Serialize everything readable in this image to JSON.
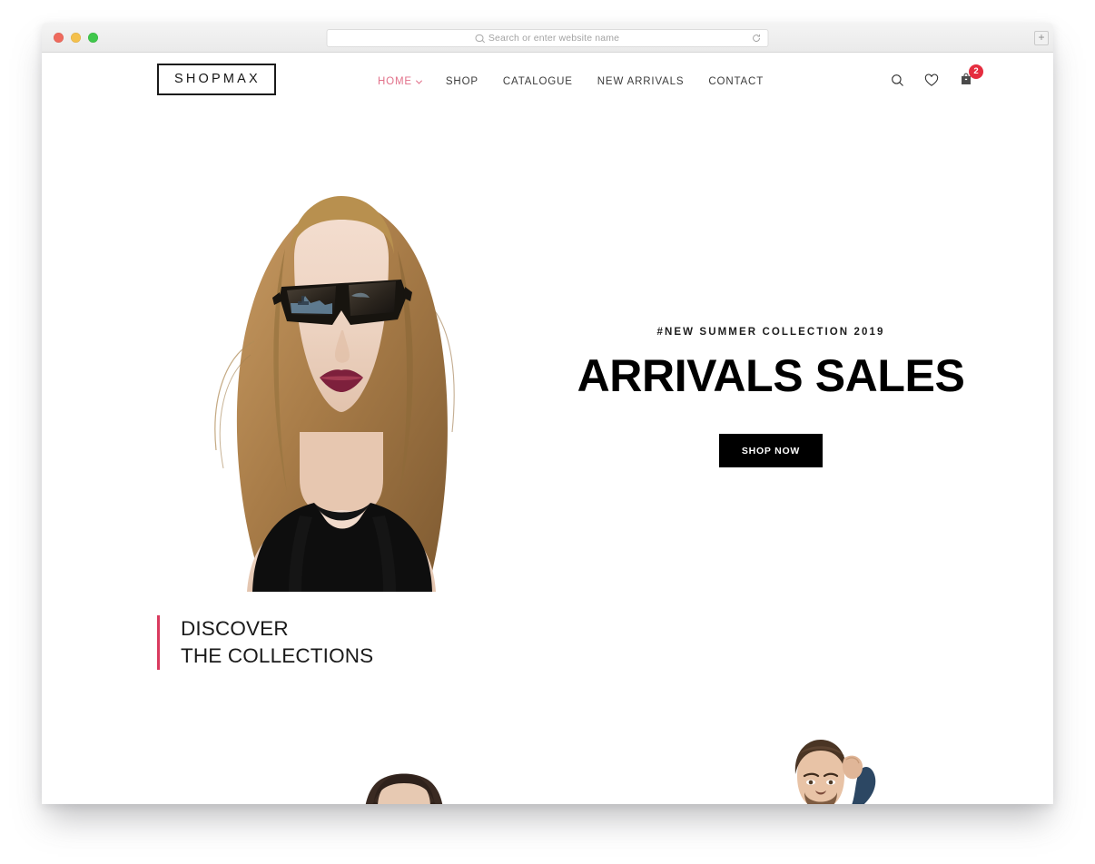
{
  "browser": {
    "traffic_lights": [
      "close",
      "minimize",
      "maximize"
    ],
    "colors": {
      "close": "#ef6a5d",
      "minimize": "#f4c04c",
      "maximize": "#3fc74b"
    },
    "address_bar": {
      "value": "",
      "placeholder": "Search or enter website name",
      "search_icon": "search-icon",
      "reload_icon": "reload-icon"
    },
    "new_tab_label": "+"
  },
  "site": {
    "logo": "SHOPMAX",
    "nav": [
      {
        "label": "HOME",
        "active": true,
        "has_dropdown": true
      },
      {
        "label": "SHOP",
        "active": false,
        "has_dropdown": false
      },
      {
        "label": "CATALOGUE",
        "active": false,
        "has_dropdown": false
      },
      {
        "label": "NEW ARRIVALS",
        "active": false,
        "has_dropdown": false
      },
      {
        "label": "CONTACT",
        "active": false,
        "has_dropdown": false
      }
    ],
    "icons": [
      {
        "name": "search-icon"
      },
      {
        "name": "heart-icon"
      },
      {
        "name": "shopping-bag-icon",
        "badge": "2"
      }
    ],
    "cart_count": "2",
    "hero": {
      "eyebrow": "#NEW SUMMER COLLECTION 2019",
      "title": "ARRIVALS SALES",
      "cta_label": "SHOP NOW",
      "image_alt": "woman wearing black sunglasses and black tank top"
    },
    "discover": {
      "title": "DISCOVER\nTHE COLLECTIONS",
      "accent_color": "#d93a5e"
    },
    "collections": [
      {
        "image_alt": "woman with long dark hair"
      },
      {
        "image_alt": "man in denim jacket with hand in hair"
      }
    ]
  },
  "theme": {
    "accent_pink": "#e2718a",
    "accent_crimson": "#d93a5e",
    "badge_red": "#e52d3f",
    "text_dark": "#1a1a1a",
    "page_bg": "#ffffff"
  }
}
